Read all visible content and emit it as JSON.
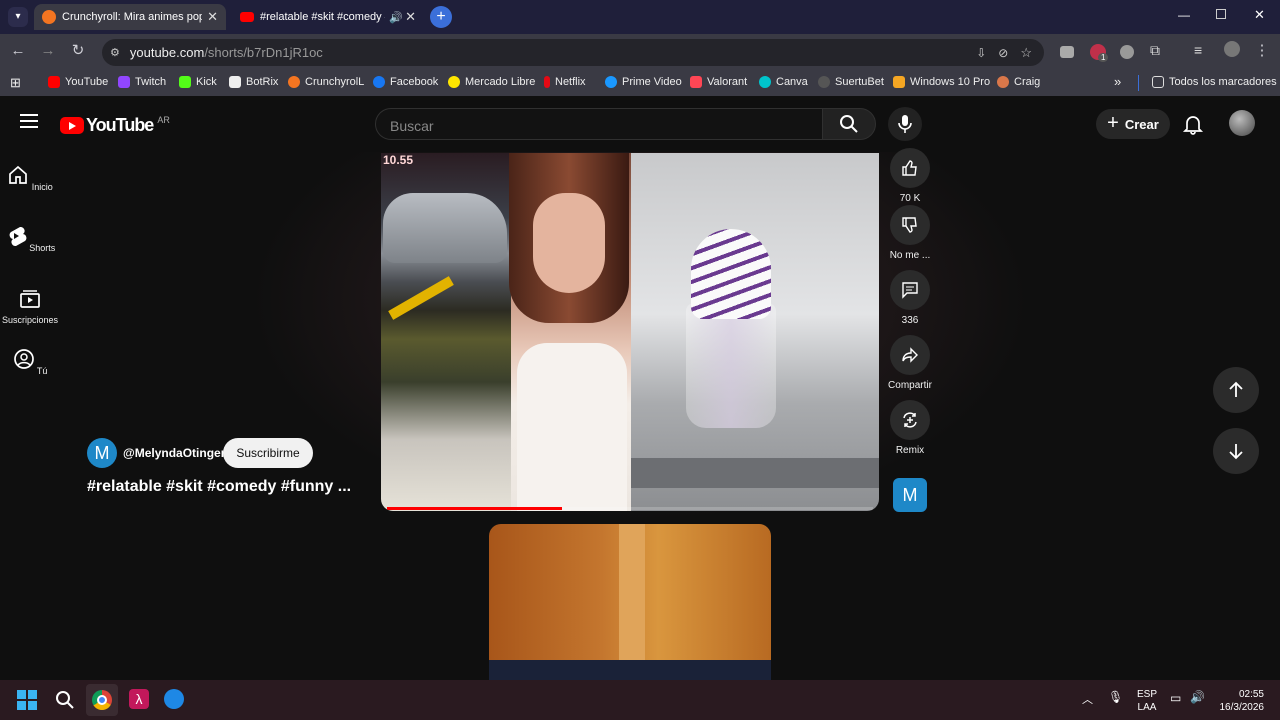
{
  "browser": {
    "tabs": [
      {
        "title": "Crunchyroll: Mira animes popul",
        "active": true
      },
      {
        "title": "#relatable #skit #comedy #",
        "active": false
      }
    ],
    "url_host": "youtube.com",
    "url_path": "/shorts/b7rDn1jR1oc",
    "bookmarks": [
      "YouTube",
      "Twitch",
      "Kick",
      "BotRix",
      "CrunchyrolL",
      "Facebook",
      "Mercado Libre",
      "Netflix",
      "Prime Video",
      "Valorant",
      "Canva",
      "SuertuBet",
      "Windows 10 Pro",
      "Craig"
    ],
    "all_bookmarks": "Todos los marcadores",
    "extension_badge": "1"
  },
  "youtube": {
    "logo_text": "YouTube",
    "region": "AR",
    "search_placeholder": "Buscar",
    "create_label": "Crear",
    "nav": [
      {
        "label": "Inicio",
        "icon": "home-icon"
      },
      {
        "label": "Shorts",
        "icon": "shorts-icon"
      },
      {
        "label": "Suscripciones",
        "icon": "subscriptions-icon"
      },
      {
        "label": "Tú",
        "icon": "you-icon"
      }
    ],
    "short": {
      "channel": "@MelyndaOtinger",
      "channel_initial": "M",
      "subscribe_label": "Suscribirme",
      "title": "#relatable #skit #comedy #funny ...",
      "video_overlay_text": "10.55",
      "progress": 0.36
    },
    "actions": {
      "likes": "70 K",
      "dislike": "No me ...",
      "comments": "336",
      "share": "Compartir",
      "remix": "Remix",
      "channel_initial": "M"
    }
  },
  "taskbar": {
    "lang": "ESP",
    "layout": "LAA",
    "time": "02:55",
    "date": "16/3/2026"
  },
  "colors": {
    "yt_red": "#ff0000",
    "progress": "#ff0000",
    "avatar": "#1e88c8"
  }
}
